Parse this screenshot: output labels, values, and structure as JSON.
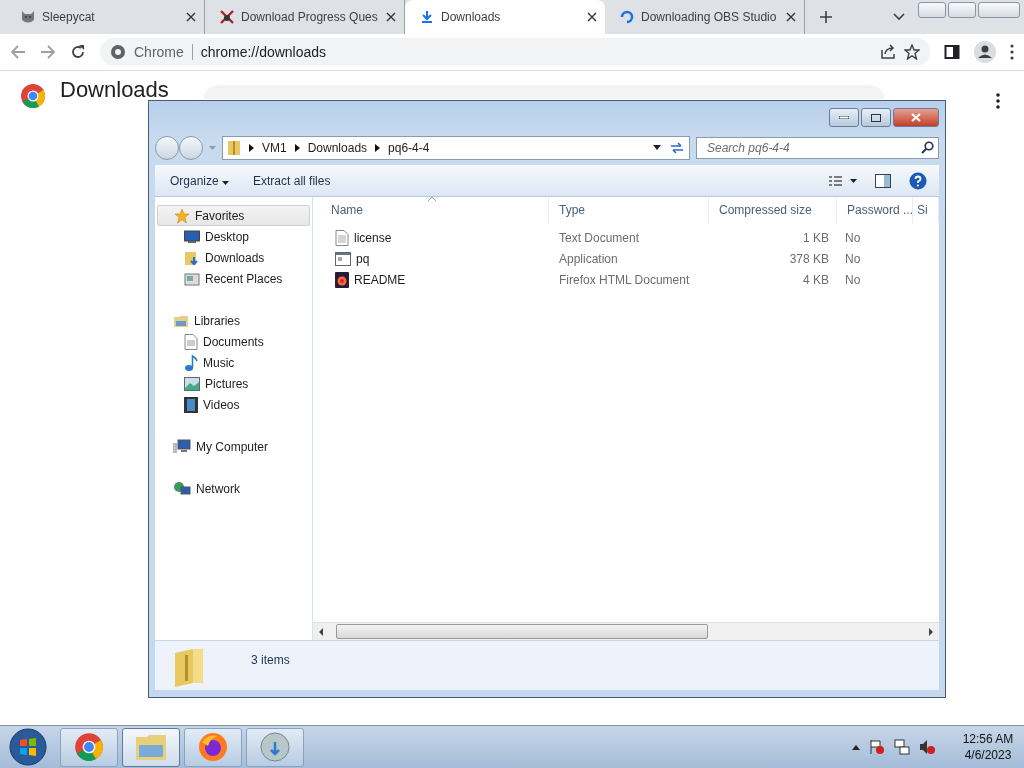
{
  "browser": {
    "tabs": [
      {
        "title": "Sleepycat",
        "kind": "cat",
        "selected": false
      },
      {
        "title": "Download Progress Ques",
        "kind": "game",
        "selected": false
      },
      {
        "title": "Downloads",
        "kind": "download",
        "selected": true
      },
      {
        "title": "Downloading OBS Studio",
        "kind": "spinner",
        "selected": false
      }
    ],
    "address": {
      "site_label": "Chrome",
      "url": "chrome://downloads"
    },
    "page": {
      "heading": "Downloads"
    }
  },
  "explorer": {
    "breadcrumb": [
      "VM1",
      "Downloads",
      "pq6-4-4"
    ],
    "search": {
      "placeholder": "Search pq6-4-4"
    },
    "toolbar": [
      "Organize",
      "Extract all files"
    ],
    "navigation": [
      {
        "label": "Favorites",
        "kind": "star",
        "selected": true,
        "children": [
          {
            "label": "Desktop",
            "kind": "desktop",
            "selected": false
          },
          {
            "label": "Downloads",
            "kind": "downloads",
            "selected": false
          },
          {
            "label": "Recent Places",
            "kind": "recent",
            "selected": false
          }
        ]
      },
      {
        "label": "Libraries",
        "kind": "library",
        "selected": false,
        "children": [
          {
            "label": "Documents",
            "kind": "document",
            "selected": false
          },
          {
            "label": "Music",
            "kind": "music",
            "selected": false
          },
          {
            "label": "Pictures",
            "kind": "pictures",
            "selected": false
          },
          {
            "label": "Videos",
            "kind": "videos",
            "selected": false
          }
        ]
      },
      {
        "label": "My Computer",
        "kind": "computer",
        "selected": false
      },
      {
        "label": "Network",
        "kind": "network",
        "selected": false
      }
    ],
    "columns": [
      {
        "label": "Name",
        "sorted": true
      },
      {
        "label": "Type",
        "sorted": false
      },
      {
        "label": "Compressed size",
        "sorted": false
      },
      {
        "label": "Password ...",
        "sorted": false
      },
      {
        "label": "Si",
        "sorted": false
      }
    ],
    "rows": [
      {
        "kind": "text",
        "cells": [
          "license",
          "Text Document",
          "1 KB",
          "No"
        ]
      },
      {
        "kind": "app",
        "cells": [
          "pq",
          "Application",
          "378 KB",
          "No"
        ]
      },
      {
        "kind": "html",
        "cells": [
          "README",
          "Firefox HTML Document",
          "4 KB",
          "No"
        ]
      }
    ],
    "status": "3 items"
  },
  "taskbar": {
    "apps": [
      {
        "kind": "chrome",
        "active": false
      },
      {
        "kind": "explorer",
        "active": true
      },
      {
        "kind": "firefox",
        "active": false
      },
      {
        "kind": "installer",
        "active": false
      }
    ],
    "time": "12:56 AM",
    "date": "4/6/2023"
  }
}
